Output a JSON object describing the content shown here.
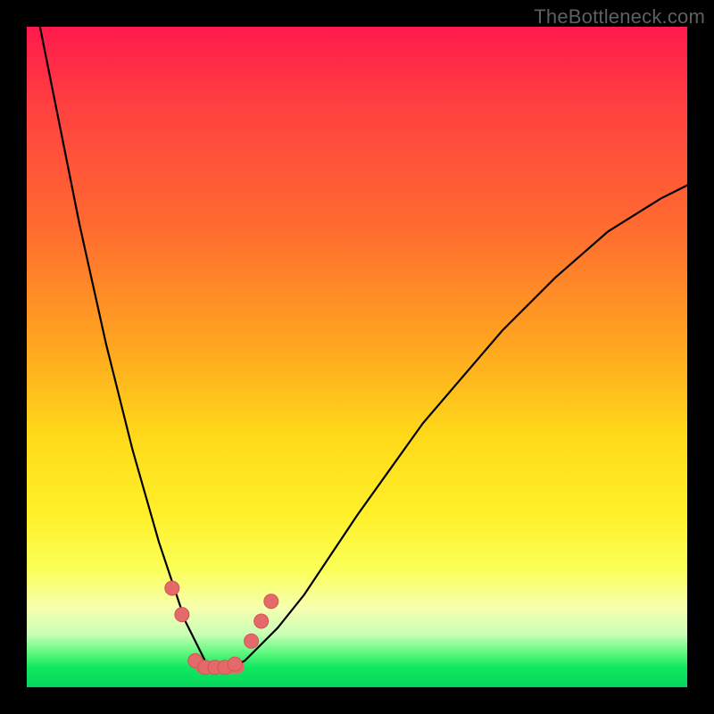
{
  "watermark": "TheBottleneck.com",
  "colors": {
    "bg_frame": "#000000",
    "gradient_top": "#ff1a4d",
    "gradient_mid": "#ffd91a",
    "gradient_bottom": "#05d65a",
    "curve": "#000000",
    "marker": "#e46a6a"
  },
  "chart_data": {
    "type": "line",
    "title": "",
    "xlabel": "",
    "ylabel": "",
    "xlim": [
      0,
      100
    ],
    "ylim": [
      0,
      100
    ],
    "grid": false,
    "legend": false,
    "series": [
      {
        "name": "bottleneck_curve",
        "x": [
          2,
          4,
          6,
          8,
          10,
          12,
          14,
          16,
          18,
          20,
          22,
          24,
          25,
          26,
          27,
          28,
          29,
          30,
          31,
          33,
          35,
          38,
          42,
          46,
          50,
          55,
          60,
          66,
          72,
          80,
          88,
          96,
          100
        ],
        "y": [
          100,
          90,
          80,
          70,
          61,
          52,
          44,
          36,
          29,
          22,
          16,
          10,
          8,
          6,
          4,
          3,
          3,
          3,
          3,
          4,
          6,
          9,
          14,
          20,
          26,
          33,
          40,
          47,
          54,
          62,
          69,
          74,
          76
        ]
      }
    ],
    "markers": [
      {
        "x": 22.0,
        "y": 15
      },
      {
        "x": 23.5,
        "y": 11
      },
      {
        "x": 25.5,
        "y": 4
      },
      {
        "x": 27.0,
        "y": 3
      },
      {
        "x": 28.5,
        "y": 3
      },
      {
        "x": 30.0,
        "y": 3
      },
      {
        "x": 31.5,
        "y": 3.5
      },
      {
        "x": 34.0,
        "y": 7
      },
      {
        "x": 35.5,
        "y": 10
      },
      {
        "x": 37.0,
        "y": 13
      }
    ],
    "flat_segment": {
      "x0": 26.5,
      "x1": 32.0,
      "y": 3
    }
  }
}
